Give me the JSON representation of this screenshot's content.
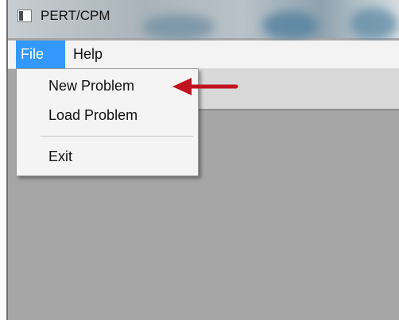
{
  "window": {
    "title": "PERT/CPM"
  },
  "menubar": {
    "file_label": "File",
    "help_label": "Help"
  },
  "file_menu": {
    "new_problem": "New Problem",
    "load_problem": "Load Problem",
    "exit": "Exit"
  },
  "colors": {
    "menu_highlight": "#3399ff",
    "workspace": "#a6a6a6",
    "arrow": "#c1121f"
  },
  "icons": {
    "app": "app-icon",
    "annotation": "arrow-left-icon"
  }
}
